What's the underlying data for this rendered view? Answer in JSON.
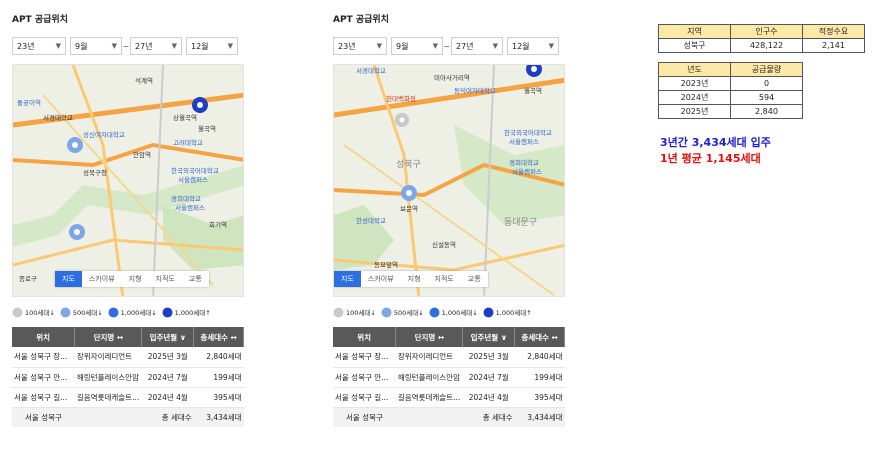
{
  "panels": [
    {
      "title": "APT 공급위치",
      "selects": {
        "from_year": "23년",
        "from_month": "9월",
        "sep": "~",
        "to_year": "27년",
        "to_month": "12월"
      },
      "map_tabs": [
        "지도",
        "스카이뷰",
        "지형",
        "지적도",
        "교통"
      ],
      "map_labels": [
        "석계역",
        "돌곶이역",
        "서경대학교",
        "상월곡역",
        "월곡역",
        "성신여자대학교",
        "고려대학교",
        "안암역",
        "성북구청",
        "한국외국어대학교",
        "서울캠퍼스",
        "경희대학교",
        "서울캠퍼스",
        "회기역",
        "종로구"
      ]
    },
    {
      "title": "APT 공급위치",
      "selects": {
        "from_year": "23년",
        "from_month": "9월",
        "sep": "~",
        "to_year": "27년",
        "to_month": "12월"
      },
      "map_tabs": [
        "지도",
        "스카이뷰",
        "지형",
        "지적도",
        "교통"
      ],
      "map_labels": [
        "서경대학교",
        "미아사거리역",
        "동덕여자대학교",
        "현대백화점",
        "월곡역",
        "한국외국어대학교",
        "서울캠퍼스",
        "경희대학교",
        "서울캠퍼스",
        "보문역",
        "신설동역",
        "동묘앞역",
        "성북구",
        "동대문구",
        "한성대학교"
      ]
    }
  ],
  "legend": [
    {
      "label": "100세대↓",
      "color": "#c9c9c9"
    },
    {
      "label": "500세대↓",
      "color": "#7fa6e6"
    },
    {
      "label": "1,000세대↓",
      "color": "#2f6fde"
    },
    {
      "label": "1,000세대↑",
      "color": "#1b3fc0"
    }
  ],
  "apt_table": {
    "headers": [
      "위치",
      "단지명 ↔",
      "입주년월 ∨",
      "총세대수 ↔"
    ],
    "rows": [
      [
        "서울 성북구 장...",
        "장위자이레디언트",
        "2025년 3월",
        "2,840세대"
      ],
      [
        "서울 성북구 안...",
        "해링턴플레이스안암",
        "2024년 7월",
        "199세대"
      ],
      [
        "서울 성북구 길...",
        "길음역롯데캐슬트...",
        "2024년 4월",
        "395세대"
      ]
    ],
    "total": [
      "서울 성북구",
      "",
      "총 세대수",
      "3,434세대"
    ]
  },
  "population_table": {
    "headers": [
      "지역",
      "인구수",
      "적정수요"
    ],
    "row": [
      "성북구",
      "428,122",
      "2,141"
    ]
  },
  "supply_table": {
    "headers": [
      "년도",
      "공급물량"
    ],
    "rows": [
      [
        "2023년",
        "0"
      ],
      [
        "2024년",
        "594"
      ],
      [
        "2025년",
        "2,840"
      ]
    ]
  },
  "summary": {
    "line1": "3년간 3,434세대 입주",
    "line2": "1년 평균 1,145세대",
    "line1_color": "#1f1fcf",
    "line2_color": "#e01010"
  }
}
